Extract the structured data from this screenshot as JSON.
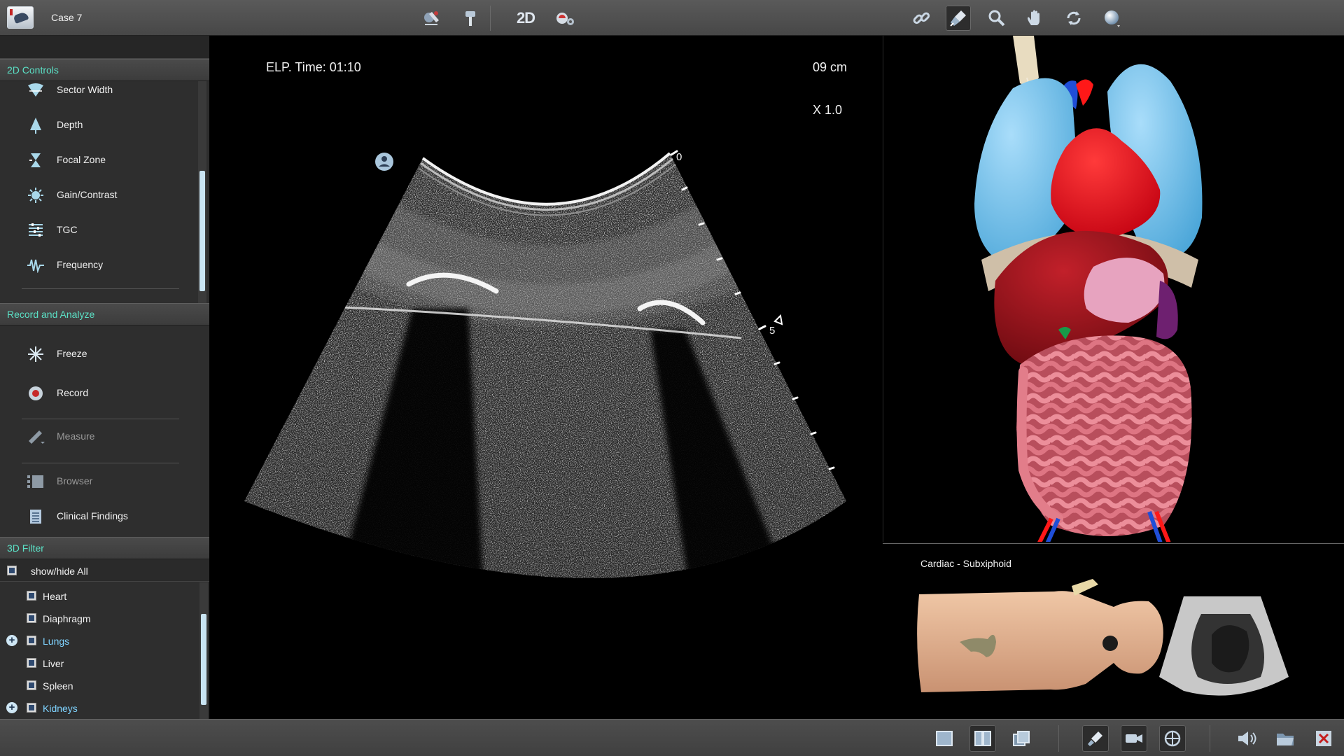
{
  "app": {
    "case_title": "Case 7",
    "top_toolbar": [
      "probe-position-icon",
      "marker-icon",
      "2d-mode-icon",
      "scan-settings-icon",
      "link-icon",
      "probe-tool-icon",
      "zoom-icon",
      "pan-hand-icon",
      "rotate-icon",
      "sphere-view-icon"
    ],
    "mode_label": "2D"
  },
  "sidebar": {
    "controls_header": "2D Controls",
    "controls": [
      {
        "label": "Sector Width",
        "icon": "sector-width-icon"
      },
      {
        "label": "Depth",
        "icon": "depth-icon"
      },
      {
        "label": "Focal Zone",
        "icon": "focal-zone-icon"
      },
      {
        "label": "Gain/Contrast",
        "icon": "gain-contrast-icon"
      },
      {
        "label": "TGC",
        "icon": "tgc-icon"
      },
      {
        "label": "Frequency",
        "icon": "frequency-icon"
      }
    ],
    "record_header": "Record and Analyze",
    "record_items": [
      {
        "label": "Freeze",
        "icon": "freeze-icon"
      },
      {
        "label": "Record",
        "icon": "record-icon"
      },
      {
        "label": "Measure",
        "icon": "measure-icon"
      },
      {
        "label": "Browser",
        "icon": "browser-icon"
      },
      {
        "label": "Clinical Findings",
        "icon": "clinical-findings-icon"
      }
    ],
    "filter_header": "3D Filter",
    "show_hide_all": "show/hide All",
    "filters": [
      {
        "label": "Heart",
        "expandable": false
      },
      {
        "label": "Diaphragm",
        "expandable": false
      },
      {
        "label": "Lungs",
        "expandable": true
      },
      {
        "label": "Liver",
        "expandable": false
      },
      {
        "label": "Spleen",
        "expandable": false
      },
      {
        "label": "Kidneys",
        "expandable": true
      }
    ]
  },
  "ultrasound": {
    "elapsed_time": "ELP. Time: 01:10",
    "depth": "09 cm",
    "zoom": "X 1.0",
    "depth_scale_top": "0",
    "depth_scale_mid": "5"
  },
  "preset": {
    "title": "Cardiac - Subxiphoid"
  },
  "bottom_toolbar": [
    "single-view-icon",
    "split-view-icon",
    "layout-view-icon",
    "probe-icon",
    "camera-icon",
    "orientation-icon",
    "audio-icon",
    "folder-icon",
    "close-icon"
  ],
  "colors": {
    "accent": "#5be1c6",
    "link": "#7fd3ff",
    "lung": "#6fc0ea",
    "heart": "#e0121e",
    "liver": "#8b0f18",
    "intestine": "#d86e7c",
    "stomach": "#e9a6c0",
    "skin": "#e7b18e"
  }
}
